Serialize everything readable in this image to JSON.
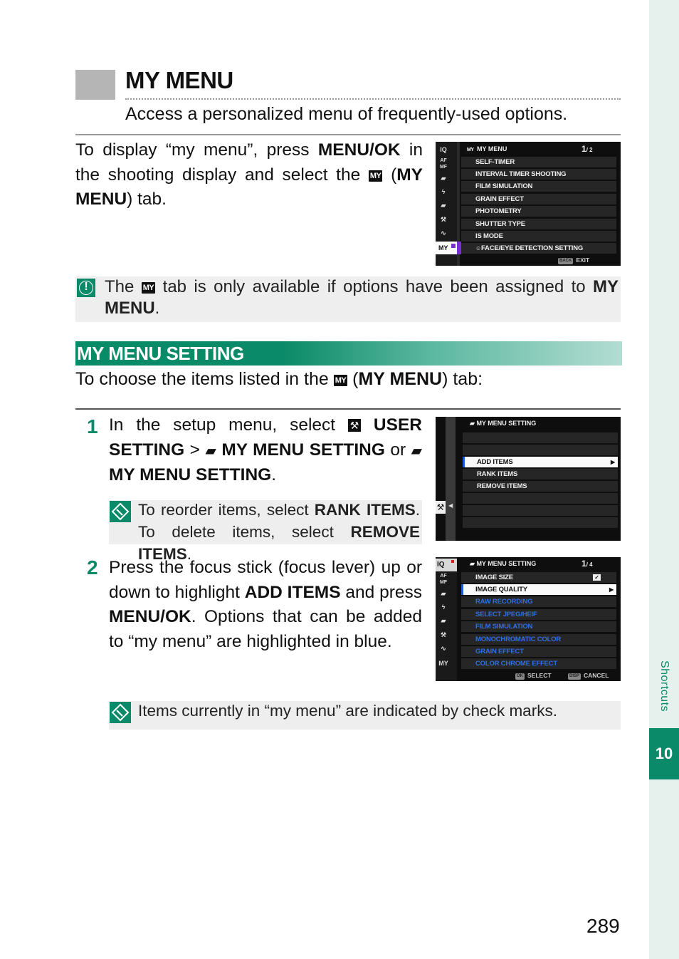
{
  "side_tab": {
    "label": "Shortcuts",
    "chapter": "10"
  },
  "header": {
    "title": "MY MENU",
    "subtitle": "Access a personalized menu of frequently-used options."
  },
  "intro": {
    "t1": "To display “my menu”, press ",
    "b1": "MENU/OK",
    "t2": " in the shooting display and select the ",
    "icon": "MY",
    "t3": " (",
    "b2": "MY MENU",
    "t4": ") tab."
  },
  "caution": {
    "icon": "caution-icon",
    "t1": "The ",
    "icon_glyph": "MY",
    "t2": " tab is only available if options have been assigned to ",
    "b1": "MY MENU",
    "t3": "."
  },
  "section": {
    "heading": "MY MENU SETTING",
    "t1": "To choose the items listed in the ",
    "icon": "MY",
    "t2": " (",
    "b1": "MY MENU",
    "t3": ") tab:"
  },
  "steps": [
    {
      "number": "1",
      "t1": "In the setup menu, select ",
      "b1": "USER SETTING",
      "t2": " > ",
      "b2": "MY MENU SETTING",
      "t3": " or ",
      "b3": "MY MENU SETTING",
      "t4": ".",
      "note": {
        "t1": "To reorder items, select ",
        "b1": "RANK ITEMS",
        "t2": ". To delete items, select ",
        "b2": "REMOVE ITEMS",
        "t3": "."
      }
    },
    {
      "number": "2",
      "t1": "Press the focus stick (focus lever) up or down to highlight ",
      "b1": "ADD ITEMS",
      "t2": " and press ",
      "b2": "MENU/OK",
      "t3": ". Options that can be added to “my menu” are highlighted in blue."
    }
  ],
  "bottom_note": "Items currently in “my menu” are indicated by check marks.",
  "page_number": "289",
  "screen1": {
    "tabs": [
      "IQ",
      "AF MF",
      "camera",
      "flash",
      "movie",
      "wrench",
      "connect",
      "MY"
    ],
    "header_icon": "MY",
    "header": "MY MENU",
    "page": "1",
    "page_total": "/ 2",
    "items": [
      "SELF-TIMER",
      "INTERVAL TIMER SHOOTING",
      "FILM SIMULATION",
      "GRAIN EFFECT",
      "PHOTOMETRY",
      "SHUTTER TYPE",
      "IS MODE",
      "FACE/EYE DETECTION SETTING"
    ],
    "footer_button": "BACK",
    "footer_label": "EXIT",
    "accent": "#7a2fd6"
  },
  "screen2": {
    "header": "MY MENU SETTING",
    "items": [
      "",
      "",
      "ADD ITEMS",
      "RANK ITEMS",
      "REMOVE ITEMS",
      "",
      "",
      ""
    ],
    "selected_index": 2
  },
  "screen3": {
    "header": "MY MENU SETTING",
    "page": "1",
    "page_total": "/ 4",
    "items": [
      {
        "label": "IMAGE SIZE",
        "state": "checked"
      },
      {
        "label": "IMAGE QUALITY",
        "state": "selected"
      },
      {
        "label": "RAW RECORDING",
        "state": "available"
      },
      {
        "label": "SELECT JPEG/HEIF",
        "state": "available"
      },
      {
        "label": "FILM SIMULATION",
        "state": "available"
      },
      {
        "label": "MONOCHROMATIC COLOR",
        "state": "available"
      },
      {
        "label": "GRAIN EFFECT",
        "state": "available"
      },
      {
        "label": "COLOR CHROME EFFECT",
        "state": "available"
      }
    ],
    "footer_ok_button": "OK",
    "footer_ok_label": "SELECT",
    "footer_cancel_button": "DISP",
    "footer_cancel_label": "CANCEL",
    "available_color": "#2f6fe6"
  }
}
